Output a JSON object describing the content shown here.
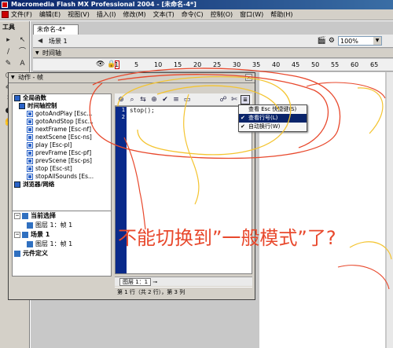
{
  "window": {
    "title": "Macromedia Flash MX Professional 2004 - [未命名-4*]"
  },
  "menubar": {
    "items": [
      "文件(F)",
      "编辑(E)",
      "视图(V)",
      "插入(I)",
      "修改(M)",
      "文本(T)",
      "命令(C)",
      "控制(O)",
      "窗口(W)",
      "帮助(H)"
    ]
  },
  "toolpanel": {
    "title": "工具",
    "tools": [
      "▸",
      "↖",
      "/",
      "⌒",
      "✎",
      "A",
      "○",
      "□",
      "✐",
      "⬚",
      "⌇",
      "✒",
      "◐",
      "◔",
      "✋",
      "⌕"
    ]
  },
  "document": {
    "tab": "未命名-4*",
    "scene": "场景 1",
    "zoom": "100%"
  },
  "timeline": {
    "header": "时间轴",
    "ruler_numbers": [
      "1",
      "5",
      "10",
      "15",
      "20",
      "25",
      "30",
      "35",
      "40",
      "45",
      "50",
      "55",
      "60",
      "65"
    ]
  },
  "actions_panel": {
    "title": "动作 - 帧",
    "close": "×",
    "toolbox": [
      {
        "label": "全局函数",
        "type": "book",
        "bold": true
      },
      {
        "label": "时间轴控制",
        "type": "book",
        "bold": true
      },
      {
        "label": "gotoAndPlay [Esc...",
        "type": "act"
      },
      {
        "label": "gotoAndStop [Esc...",
        "type": "act"
      },
      {
        "label": "nextFrame [Esc-nf]",
        "type": "act"
      },
      {
        "label": "nextScene [Esc-ns]",
        "type": "act"
      },
      {
        "label": "play [Esc-pl]",
        "type": "act"
      },
      {
        "label": "prevFrame [Esc-pf]",
        "type": "act"
      },
      {
        "label": "prevScene [Esc-ps]",
        "type": "act"
      },
      {
        "label": "stop [Esc-st]",
        "type": "act"
      },
      {
        "label": "stopAllSounds [Es...",
        "type": "act"
      },
      {
        "label": "浏览器/网络",
        "type": "book",
        "bold": true
      }
    ],
    "tree": [
      {
        "label": "当前选择",
        "expand": "−",
        "bold": true,
        "indent": 0
      },
      {
        "label": "图层 1：帧 1",
        "expand": "",
        "bold": false,
        "indent": 16
      },
      {
        "label": "场景 1",
        "expand": "−",
        "bold": true,
        "indent": 0
      },
      {
        "label": "图层 1：帧 1",
        "expand": "",
        "bold": false,
        "indent": 16
      },
      {
        "label": "元件定义",
        "expand": "",
        "bold": true,
        "indent": 0
      }
    ],
    "script_lines": [
      "1",
      "2"
    ],
    "code": [
      "stop();",
      ""
    ],
    "layer_tab": "图层 1：1",
    "status": "第 1 行（共 2 行），第 3 列"
  },
  "context_menu": {
    "items": [
      {
        "label": "查看 Esc 快捷键(S)",
        "checked": false,
        "highlight": false
      },
      {
        "label": "查看行号(L)",
        "checked": true,
        "highlight": true
      },
      {
        "label": "自动换行(W)",
        "checked": true,
        "highlight": false
      }
    ]
  },
  "annotation": {
    "text": "不能切换到”一般模式”了?",
    "color": "#e8482c"
  }
}
